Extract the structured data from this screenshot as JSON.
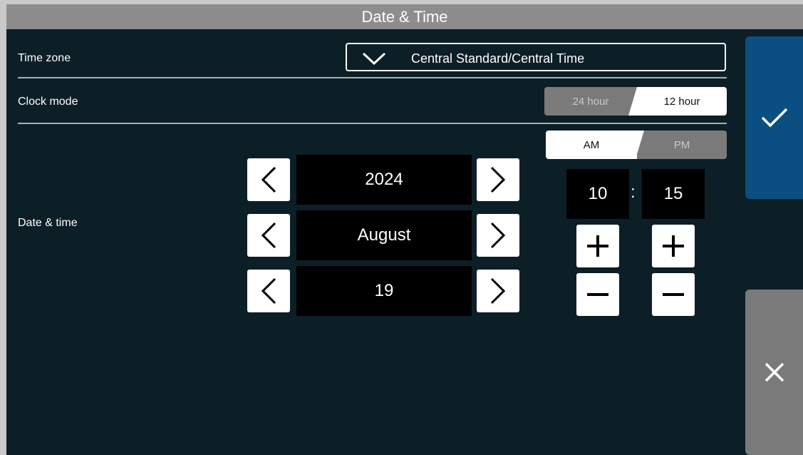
{
  "title": "Date & Time",
  "time_zone": {
    "label": "Time zone",
    "value": "Central Standard/Central Time",
    "icon": "chevron-down-icon"
  },
  "clock_mode": {
    "label": "Clock mode",
    "options": [
      "24 hour",
      "12 hour"
    ],
    "selected": "12 hour"
  },
  "date_time": {
    "label": "Date & time",
    "year": "2024",
    "month": "August",
    "day": "19",
    "ampm": {
      "options": [
        "AM",
        "PM"
      ],
      "selected": "AM"
    },
    "hour": "10",
    "separator": ":",
    "minute": "15"
  },
  "actions": {
    "confirm_icon": "check-icon",
    "cancel_icon": "close-icon"
  },
  "colors": {
    "background": "#0c1e26",
    "titlebar": "#8d8d8d",
    "confirm": "#0b4f82",
    "cancel": "#7a7a7a"
  }
}
